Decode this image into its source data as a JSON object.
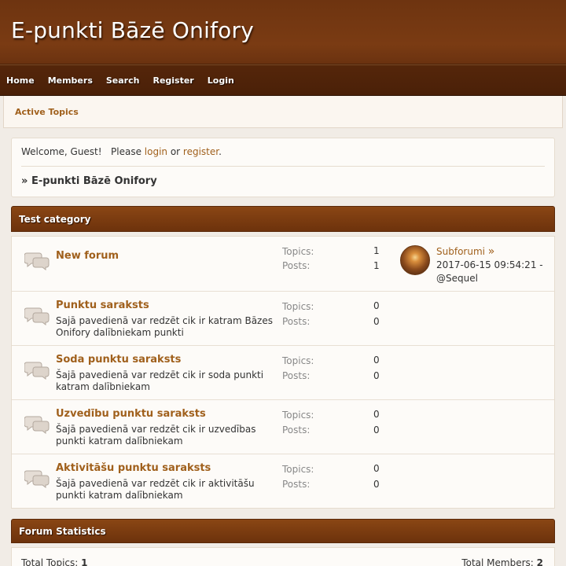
{
  "site": {
    "title": "E-punkti Bāzē Onifory"
  },
  "nav": [
    "Home",
    "Members",
    "Search",
    "Register",
    "Login"
  ],
  "subnav": {
    "active_topics": "Active Topics"
  },
  "welcome": {
    "prefix": "Welcome, Guest!   Please ",
    "login": "login",
    "or": " or ",
    "register": "register",
    "suffix": "."
  },
  "breadcrumb": {
    "arrow": "» ",
    "current": "E-punkti Bāzē Onifory"
  },
  "category": {
    "title": "Test category",
    "topics_label": "Topics:",
    "posts_label": "Posts:",
    "boards": [
      {
        "title": "New forum",
        "desc": "",
        "topics": "1",
        "posts": "1"
      },
      {
        "title": "Punktu saraksts",
        "desc": "Sajā pavedienā var redzēt cik ir katram Bāzes Onifory dalībniekam punkti",
        "topics": "0",
        "posts": "0"
      },
      {
        "title": "Soda punktu saraksts",
        "desc": "Šajā pavedienā var redzēt cik ir soda punkti katram dalībniekam",
        "topics": "0",
        "posts": "0"
      },
      {
        "title": "Uzvedību punktu saraksts",
        "desc": "Šajā pavedienā var redzēt cik ir uzvedības punkti katram dalībniekam",
        "topics": "0",
        "posts": "0"
      },
      {
        "title": "Aktivitāšu punktu saraksts",
        "desc": "Šajā pavedienā var redzēt cik ir aktivitāšu punkti katram dalībniekam",
        "topics": "0",
        "posts": "0"
      }
    ],
    "last_post": {
      "subject": "Subforumi",
      "arrow": "»",
      "datetime": "2017-06-15 09:54:21 -",
      "author": "@Sequel"
    }
  },
  "stats": {
    "title": "Forum Statistics",
    "total_topics_label": "Total Topics: ",
    "total_topics": "1",
    "total_members_label": "Total Members: ",
    "total_members": "2"
  },
  "icons": {
    "board": "speech-bubbles-icon",
    "avatar": "sunset-avatar"
  },
  "colors": {
    "header": "#7a3b13",
    "nav": "#4a2008",
    "link": "#a0601c",
    "category_bar": "#7a3b10"
  }
}
